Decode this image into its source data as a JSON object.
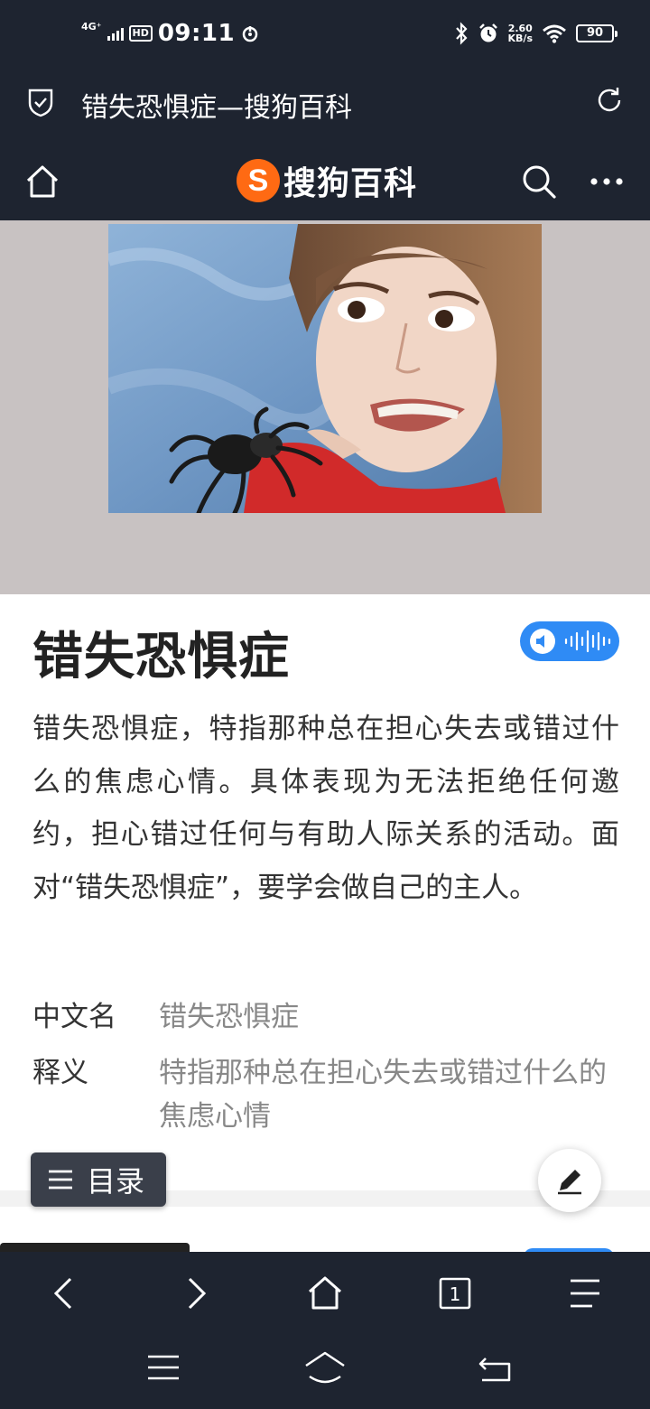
{
  "status_bar": {
    "network": "4G⁺",
    "hd_badge": "HD",
    "time": "09:11",
    "speed_value": "2.60",
    "speed_unit": "KB/s",
    "battery": "90"
  },
  "url_bar": {
    "page_title": "错失恐惧症—搜狗百科"
  },
  "site_header": {
    "logo_letter": "S",
    "logo_text": "搜狗百科"
  },
  "article": {
    "title": "错失恐惧症",
    "summary": "错失恐惧症，特指那种总在担心失去或错过什么的焦虑心情。具体表现为无法拒绝任何邀约，担心错过任何与有助人际关系的活动。面对“错失恐惧症”，要学会做自己的主人。",
    "info": [
      {
        "key": "中文名",
        "value": "错失恐惧症"
      },
      {
        "key": "释义",
        "value": "特指那种总在担心失去或错过什么的焦虑心情"
      }
    ]
  },
  "floating": {
    "toc_label": "目录"
  },
  "toolbar": {
    "tab_count": "1"
  },
  "colors": {
    "dark_bg": "#1e2430",
    "accent_blue": "#2f8bf5",
    "logo_orange": "#ff6a13"
  },
  "icons": [
    "shield-icon",
    "reload-icon",
    "home-icon",
    "search-icon",
    "more-icon",
    "audio-icon",
    "menu-icon",
    "edit-icon",
    "back-icon",
    "forward-icon",
    "tabs-icon"
  ]
}
